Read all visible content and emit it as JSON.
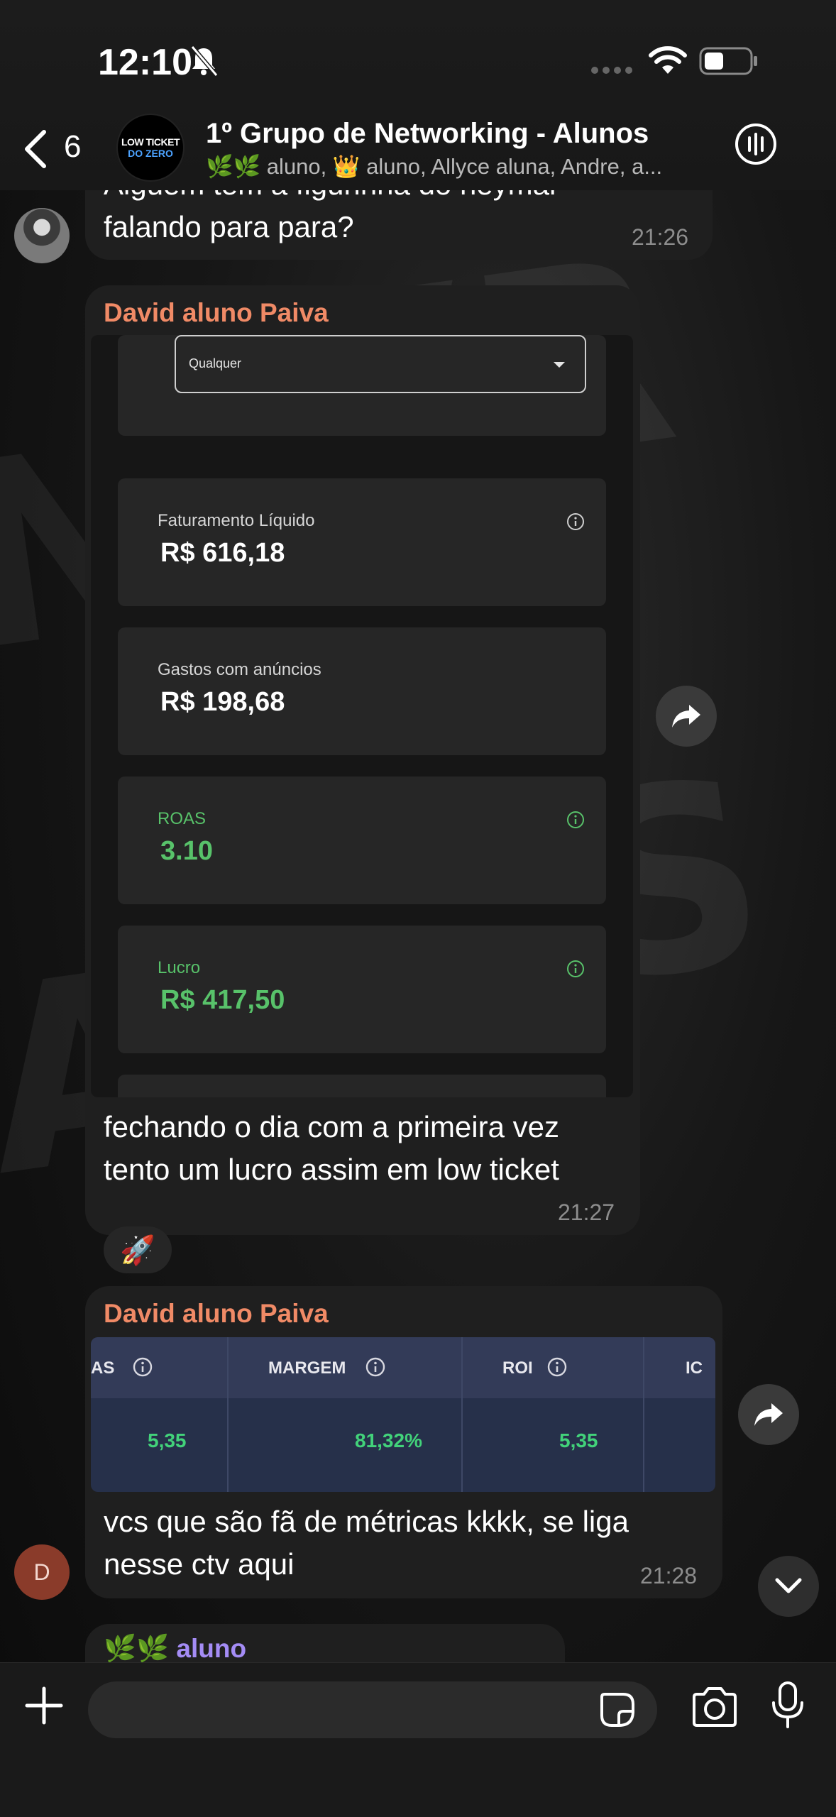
{
  "status_bar": {
    "time": "12:10"
  },
  "header": {
    "back_count": "6",
    "group_avatar_line1": "LOW TICKET",
    "group_avatar_line2": "DO ZERO",
    "title": "1º Grupo de Networking - Alunos",
    "members": "🌿🌿 aluno, 👑 aluno, Allyce aluna, Andre, a..."
  },
  "messages": [
    {
      "text": "Alguém tem a figurinha do neymar falando para para?",
      "line1": "Alguém tem a figurinha do neymar",
      "line2": "falando para para?",
      "time": "21:26"
    },
    {
      "sender": "David aluno Paiva",
      "sender_color": "#f08a66",
      "dashboard": {
        "dropdown_value": "Qualquer",
        "cards": [
          {
            "label": "Faturamento Líquido",
            "value": "R$ 616,18"
          },
          {
            "label": "Gastos com anúncios",
            "value": "R$ 198,68"
          },
          {
            "label": "ROAS",
            "value": "3.10"
          },
          {
            "label": "Lucro",
            "value": "R$ 417,50"
          }
        ]
      },
      "line1": "fechando o dia com a primeira vez",
      "line2": "tento um lucro assim em low ticket",
      "time": "21:27",
      "reaction": "🚀"
    },
    {
      "sender": "David aluno Paiva",
      "metrics": {
        "headers": [
          "AS",
          "MARGEM",
          "ROI",
          "IC"
        ],
        "values": [
          "5,35",
          "81,32%",
          "5,35"
        ]
      },
      "line1": "vcs que são fã de métricas kkkk, se liga",
      "line2": "nesse ctv aqui",
      "time": "21:28",
      "avatar_initial": "D"
    },
    {
      "sender": "🌿🌿 aluno",
      "sender_color": "#a48cf5"
    }
  ],
  "colors": {
    "accent_green": "#58c26a",
    "sender_orange": "#f08a66",
    "sender_purple": "#a48cf5"
  }
}
